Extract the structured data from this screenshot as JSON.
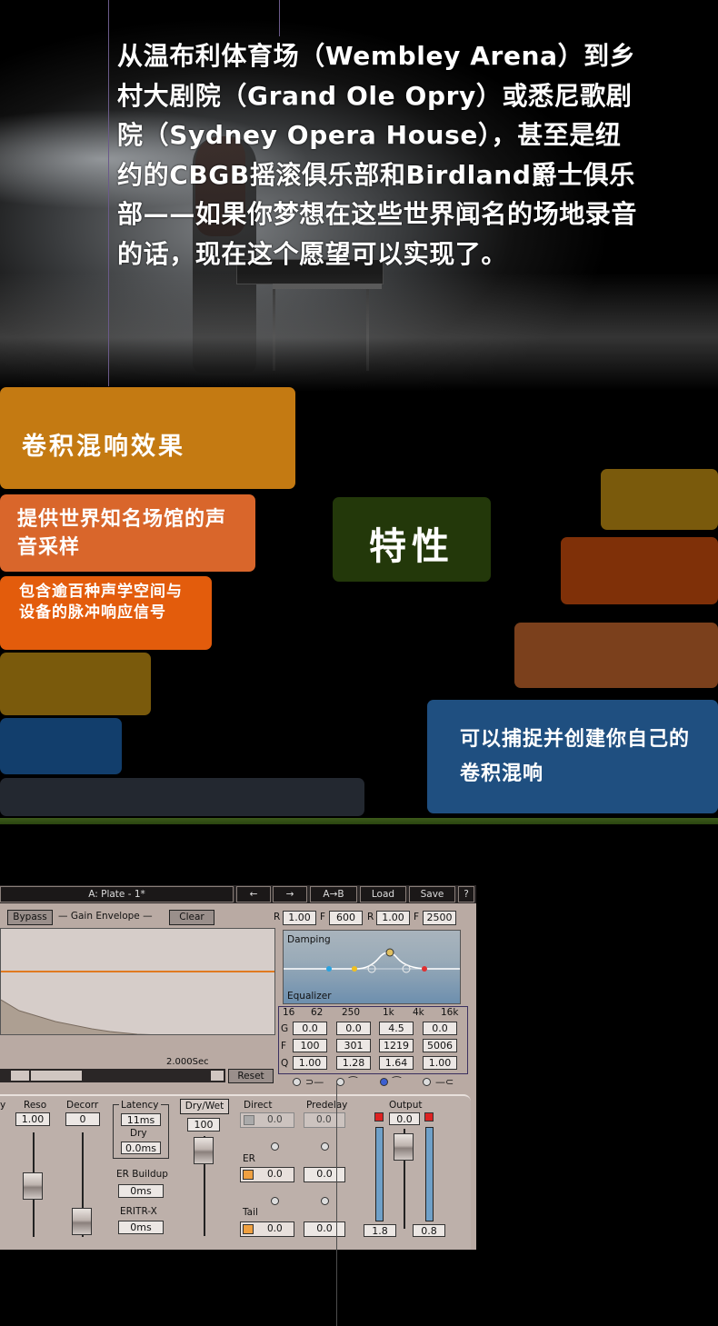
{
  "hero": {
    "text": "从温布利体育场（Wembley Arena）到乡村大剧院（Grand Ole Opry）或悉尼歌剧院（Sydney Opera House），甚至是纽约的CBGB摇滚俱乐部和Birdland爵士俱乐部——如果你梦想在这些世界闻名的场地录音的话，现在这个愿望可以实现了。"
  },
  "tiles": {
    "reverb": "卷积混响效果",
    "venues": "提供世界知名场馆的声音采样",
    "impulses": "包含逾百种声学空间与设备的脉冲响应信号",
    "features": "特性",
    "create": "可以捕捉并创建你自己的卷积混响"
  },
  "plugin": {
    "preset": "A: Plate - 1*",
    "prev_icon": "←",
    "next_icon": "→",
    "ab_label": "A→B",
    "load_label": "Load",
    "save_label": "Save",
    "help_label": "?",
    "bypass_label": "Bypass",
    "gain_envelope_label": "Gain Envelope",
    "clear_label": "Clear",
    "r_label": "R",
    "r_value": "1.00",
    "f1_label": "F",
    "f1_value": "600",
    "r2_label": "R",
    "r2_value": "1.00",
    "f2_label": "F",
    "f2_value": "2500",
    "time_label": "2.000Sec",
    "reset_label": "Reset",
    "damping_label": "Damping",
    "equalizer_label": "Equalizer",
    "eq_freqs": [
      "16",
      "62",
      "250",
      "1k",
      "4k",
      "16k"
    ],
    "eq_rows": [
      {
        "label": "G",
        "values": [
          "0.0",
          "0.0",
          "4.5",
          "0.0"
        ]
      },
      {
        "label": "F",
        "values": [
          "100",
          "301",
          "1219",
          "5006"
        ]
      },
      {
        "label": "Q",
        "values": [
          "1.00",
          "1.28",
          "1.64",
          "1.00"
        ]
      }
    ],
    "controls": {
      "reso_label": "Reso",
      "reso_value": "1.00",
      "decorr_label": "Decorr",
      "decorr_value": "0",
      "latency_label": "Latency",
      "latency_value": "11ms",
      "dry_label": "Dry",
      "dry_value": "0.0ms",
      "er_buildup_label": "ER Buildup",
      "er_buildup_value": "0ms",
      "eritr_label": "ERITR-X",
      "eritr_value": "0ms",
      "drywet_label": "Dry/Wet",
      "drywet_value": "100",
      "direct_label": "Direct",
      "direct_value": "0.0",
      "predelay_label": "Predelay",
      "predelay_value": "0.0",
      "er_label": "ER",
      "er_value": "0.0",
      "er_value2": "0.0",
      "tail_label": "Tail",
      "tail_value": "0.0",
      "tail_value2": "0.0",
      "output_label": "Output",
      "output_value": "0.0",
      "meter_left": "1.8",
      "meter_right": "0.8"
    }
  }
}
